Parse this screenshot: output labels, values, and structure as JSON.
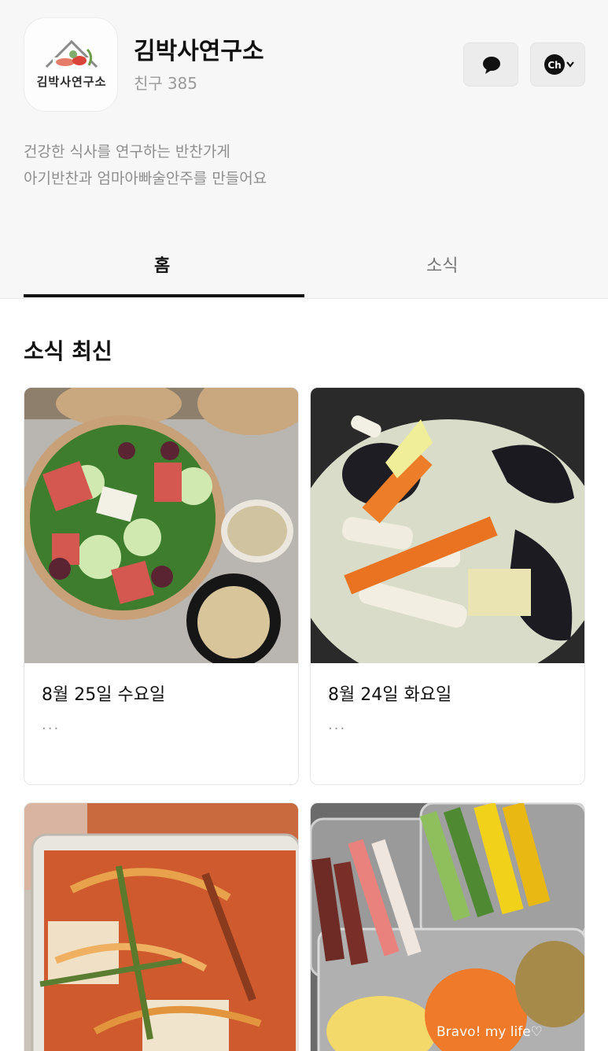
{
  "profile": {
    "logo_text": "김박사연구소",
    "name": "김박사연구소",
    "friend_label": "친구",
    "friend_count": "385"
  },
  "actions": {
    "chat_icon": "speech-bubble-icon",
    "channel_label": "Ch",
    "channel_icon": "chevron-down-icon"
  },
  "bio": {
    "line1": "건강한 식사를 연구하는 반찬가게",
    "line2": "아기반찬과 엄마아빠술안주를 만들어요"
  },
  "tabs": [
    {
      "label": "홈",
      "active": true
    },
    {
      "label": "소식",
      "active": false
    }
  ],
  "section": {
    "title": "소식 최신"
  },
  "posts": [
    {
      "title": "8월 25일 수요일",
      "preview": "...",
      "image": "salad-photo"
    },
    {
      "title": "8월 24일 화요일",
      "preview": "...",
      "image": "mussel-squid-stew-photo"
    },
    {
      "title": "",
      "preview": "",
      "image": "spicy-tofu-kimchi-photo"
    },
    {
      "title": "",
      "preview": "",
      "image": "gimbap-ingredients-photo",
      "watermark": "Bravo! my life♡"
    }
  ],
  "colors": {
    "header_bg": "#f7f7f7",
    "active_tab": "#111111",
    "muted_text": "#8e8e8e"
  }
}
